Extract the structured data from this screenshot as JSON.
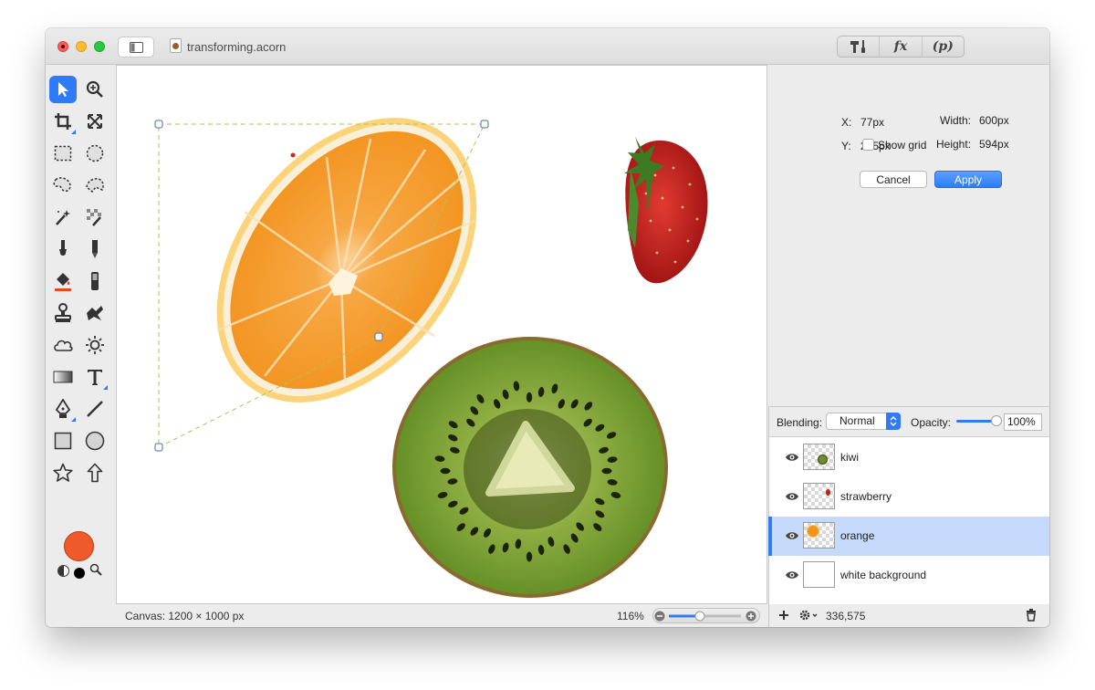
{
  "window": {
    "title": "transforming.acorn"
  },
  "header_tabs": {
    "tools": "tools-icon",
    "fx": "fx",
    "p": "(p)"
  },
  "tools": [
    "move-icon",
    "zoom-icon",
    "crop-icon",
    "transform-icon",
    "rect-select-icon",
    "ellipse-select-icon",
    "lasso-icon",
    "polygon-lasso-icon",
    "magic-wand-icon",
    "color-select-icon",
    "brush-icon",
    "pencil-icon",
    "paint-bucket-icon",
    "eraser-icon",
    "clone-stamp-icon",
    "retouch-icon",
    "cloud-icon",
    "sun-icon",
    "gradient-icon",
    "text-icon",
    "pen-icon",
    "line-icon",
    "rectangle-icon",
    "circle-icon",
    "star-icon",
    "arrow-icon"
  ],
  "colors": {
    "foreground": "#f05a2a",
    "accent": "#2f7bf6"
  },
  "inspector": {
    "x_label": "X:",
    "x_value": "77px",
    "y_label": "Y:",
    "y_value": "295px",
    "width_label": "Width:",
    "width_value": "600px",
    "height_label": "Height:",
    "height_value": "594px",
    "show_grid": "Show grid",
    "cancel": "Cancel",
    "apply": "Apply"
  },
  "blending": {
    "label": "Blending:",
    "value": "Normal",
    "opacity_label": "Opacity:",
    "opacity_value": "100%"
  },
  "layers": [
    {
      "name": "kiwi",
      "selected": false
    },
    {
      "name": "strawberry",
      "selected": false
    },
    {
      "name": "orange",
      "selected": true
    },
    {
      "name": "white background",
      "selected": false
    }
  ],
  "status": {
    "canvas": "Canvas: 1200 × 1000 px",
    "zoom": "116%",
    "coords": "336,575"
  }
}
